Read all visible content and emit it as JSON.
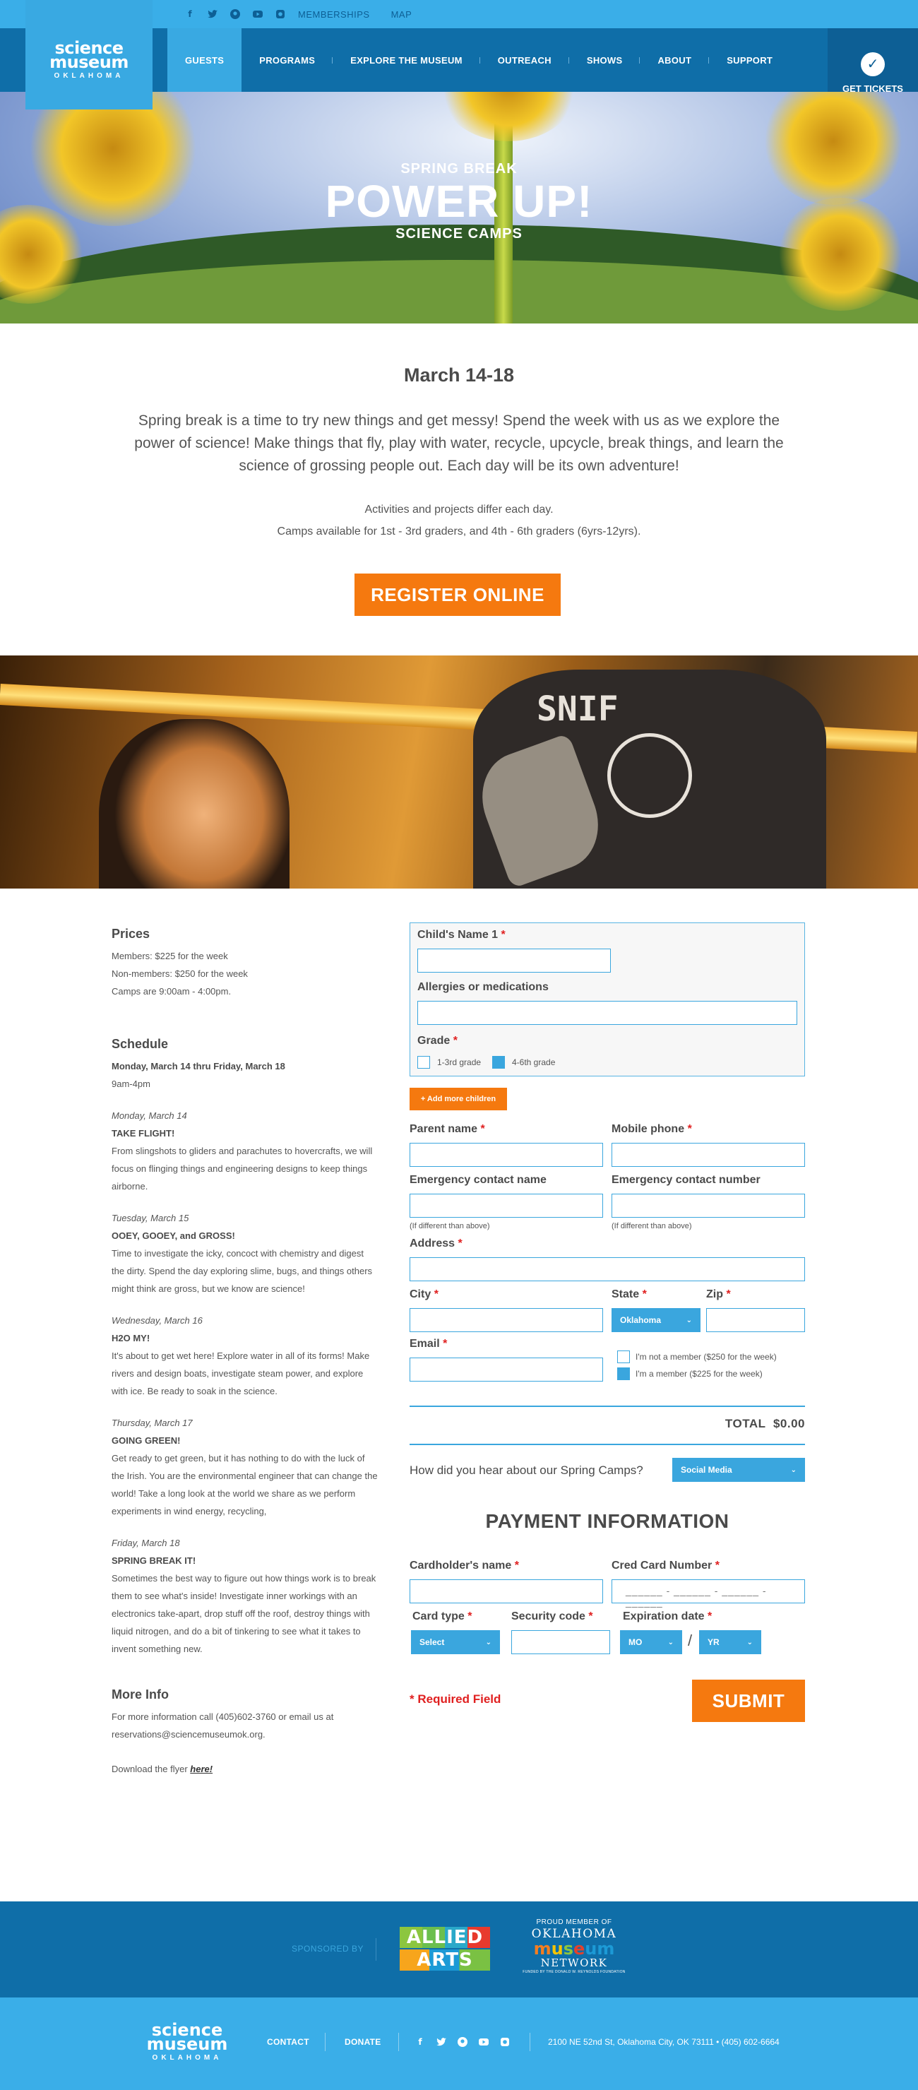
{
  "header": {
    "top_links": [
      "MEMBERSHIPS",
      "MAP"
    ],
    "social_icons": [
      "facebook-icon",
      "twitter-icon",
      "pinterest-icon",
      "youtube-icon",
      "instagram-icon"
    ],
    "logo": {
      "line1": "science",
      "line2": "museum",
      "line3": "OKLAHOMA"
    },
    "nav": [
      "GUESTS",
      "PROGRAMS",
      "EXPLORE THE MUSEUM",
      "OUTREACH",
      "SHOWS",
      "ABOUT",
      "SUPPORT"
    ],
    "active_nav": "GUESTS",
    "tickets_label": "GET TICKETS"
  },
  "hero": {
    "line1": "SPRING BREAK",
    "title": "POWER UP!",
    "line2": "SCIENCE CAMPS"
  },
  "intro": {
    "date": "March 14-18",
    "text": "Spring break is a time to try new things and get messy! Spend the week with us as we explore the power of science! Make things that fly, play with water, recycle, upcycle, break things, and learn the science of grossing people out. Each day will be its own adventure!",
    "note1": "Activities and projects differ each day.",
    "note2": "Camps available for 1st - 3rd graders, and 4th - 6th graders (6yrs-12yrs).",
    "register_label": "REGISTER ONLINE"
  },
  "photo": {
    "shirt_text": "SNIF"
  },
  "prices": {
    "heading": "Prices",
    "lines": [
      "Members: $225 for the week",
      "Non-members: $250 for the week",
      "Camps are 9:00am - 4:00pm."
    ]
  },
  "schedule": {
    "heading": "Schedule",
    "range": "Monday, March 14 thru Friday, March 18",
    "hours": "9am-4pm",
    "days": [
      {
        "date": "Monday, March 14",
        "title": "TAKE FLIGHT!",
        "text": "From slingshots to gliders and parachutes to hovercrafts, we will focus on flinging things and engineering designs to keep things airborne."
      },
      {
        "date": "Tuesday, March 15",
        "title": "OOEY, GOOEY, and GROSS!",
        "text": "Time to investigate the icky, concoct with chemistry and digest the dirty. Spend the day exploring slime, bugs, and things others might think are gross, but we know are science!"
      },
      {
        "date": "Wednesday, March 16",
        "title": "H2O MY!",
        "text": "It's about to get wet here! Explore water in all of its forms! Make rivers and design boats, investigate steam power, and explore with ice. Be ready to soak in the science."
      },
      {
        "date": "Thursday, March 17",
        "title": "GOING GREEN!",
        "text": "Get ready to get green, but it has nothing to do with the luck of the Irish. You are the environmental engineer that can change the world! Take a long look at the world we share as we perform experiments in wind energy, recycling,"
      },
      {
        "date": "Friday, March 18",
        "title": "SPRING BREAK IT!",
        "text": "Sometimes the best way to figure out how things work is to break them to see what's inside! Investigate inner workings with an electronics take-apart, drop stuff off the roof, destroy things with liquid nitrogen, and do a bit of tinkering to see what it takes to invent something new."
      }
    ]
  },
  "more_info": {
    "heading": "More Info",
    "text": "For more information call (405)602-3760 or email us at reservations@sciencemuseumok.org.",
    "flyer_prefix": "Download the flyer ",
    "flyer_link": "here!"
  },
  "form": {
    "child_name_label": "Child's Name 1",
    "allergies_label": "Allergies or medications",
    "grade_label": "Grade",
    "grade_options": [
      {
        "label": "1-3rd grade",
        "checked": false
      },
      {
        "label": "4-6th grade",
        "checked": true
      }
    ],
    "add_children_label": "+ Add more children",
    "parent_name_label": "Parent name",
    "mobile_phone_label": "Mobile phone",
    "emergency_name_label": "Emergency contact name",
    "emergency_number_label": "Emergency contact number",
    "emergency_name_hint": "(If different than above)",
    "emergency_number_hint": "(If different than above)",
    "address_label": "Address",
    "city_label": "City",
    "state_label": "State",
    "state_value": "Oklahoma",
    "zip_label": "Zip",
    "email_label": "Email",
    "membership_options": [
      {
        "label": "I'm not a member ($250 for the week)",
        "checked": false
      },
      {
        "label": "I'm a member ($225 for the week)",
        "checked": true
      }
    ],
    "total_label": "TOTAL",
    "total_value": "$0.00",
    "hear_label": "How did you hear about our Spring Camps?",
    "hear_value": "Social Media",
    "required_mark": "*"
  },
  "payment": {
    "heading": "PAYMENT INFORMATION",
    "cardholder_label": "Cardholder's name",
    "card_number_label": "Cred Card Number",
    "card_number_mask": "______ - ______ - ______ - ______",
    "card_type_label": "Card type",
    "card_type_value": "Select",
    "security_label": "Security code",
    "expiration_label": "Expiration date",
    "month_value": "MO",
    "year_value": "YR",
    "slash": "/",
    "required_note": "* Required Field",
    "submit_label": "SUBMIT"
  },
  "footer": {
    "sponsored_by": "SPONSORED BY",
    "allied_line1": "ALLIED",
    "allied_line2": "ARTS",
    "network": {
      "line1": "PROUD MEMBER OF",
      "line2": "OKLAHOMA",
      "museum_letters": [
        "m",
        "u",
        "s",
        "e",
        "um"
      ],
      "line4": "NETWORK",
      "line5": "FUNDED BY THE DONALD W. REYNOLDS FOUNDATION"
    },
    "logo": {
      "line1": "science",
      "line2": "museum",
      "line3": "OKLAHOMA"
    },
    "links": [
      "CONTACT",
      "DONATE"
    ],
    "address": "2100 NE 52nd St, Oklahoma City, OK 73111  •  (405) 602-6664"
  },
  "colors": {
    "light_blue": "#3aaee8",
    "dark_blue": "#0f6ea8",
    "orange": "#f5790f",
    "required_red": "#e02020"
  }
}
